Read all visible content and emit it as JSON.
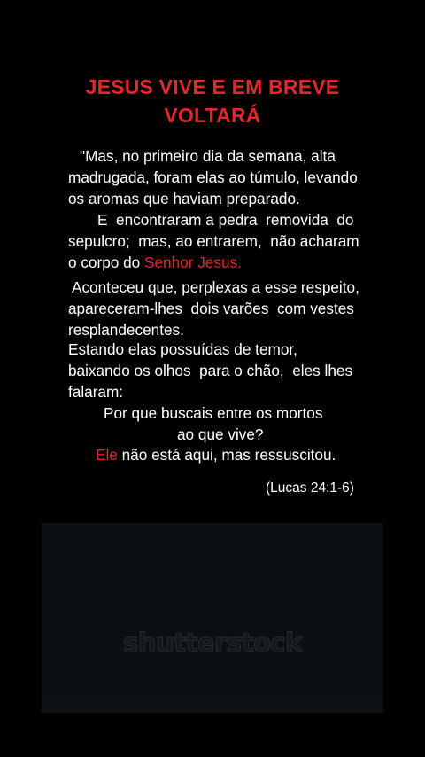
{
  "title": {
    "line1": "JESUS VIVE E EM BREVE",
    "line2": "VOLTARÁ"
  },
  "verse": {
    "l1": "\"Mas, no primeiro dia da semana, alta",
    "l2": "madrugada, foram elas ao túmulo, levando",
    "l3": "os aromas que haviam preparado.",
    "l4": "E  encontraram a pedra  removida  do",
    "l5": "sepulcro;  mas, ao entrarem,  não acharam",
    "l6_prefix": "o corpo do ",
    "l6_highlight": "Senhor Jesus.",
    "l7": "Aconteceu que, perplexas a esse respeito,",
    "l8": "apareceram-lhes  dois varões  com vestes",
    "l9": "resplandecentes.",
    "l10": "Estando elas possuídas de temor,",
    "l11": "baixando os olhos  para o chão,  eles lhes",
    "l12": "falaram:",
    "l13": "Por que buscais entre os mortos",
    "l14": "ao que vive?",
    "l15_highlight": "Ele",
    "l15_rest": " não está aqui, mas ressuscitou."
  },
  "reference": "(Lucas 24:1-6)",
  "watermark": "shutterstock",
  "colors": {
    "background": "#000000",
    "accent_red": "#e0282e",
    "text": "#ffffff"
  }
}
